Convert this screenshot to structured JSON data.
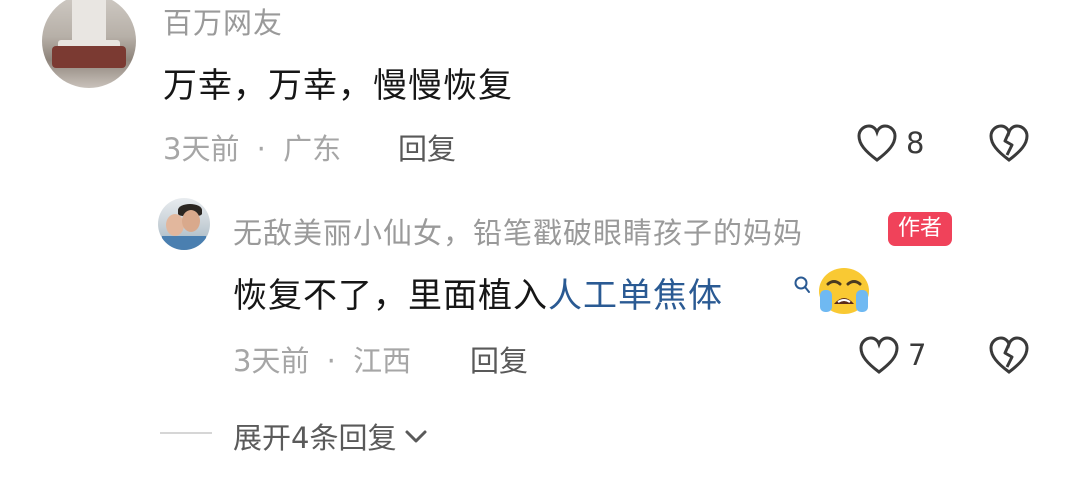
{
  "comment": {
    "username": "百万网友",
    "text": "万幸，万幸，慢慢恢复",
    "time": "3天前",
    "dot": "·",
    "location": "广东",
    "reply_label": "回复",
    "like_count": "8",
    "reply": {
      "username": "无敌美丽小仙女，铅笔戳破眼睛孩子的妈妈",
      "badge": "作者",
      "text_before": "恢复不了，里面植入",
      "link_text": "人工单焦体",
      "time": "3天前",
      "dot": "·",
      "location": "江西",
      "reply_label": "回复",
      "like_count": "7"
    },
    "expand_label": "展开4条回复"
  },
  "colors": {
    "author_badge": "#f0425a",
    "link": "#2a5a93",
    "emoji_yellow": "#f9c933"
  },
  "icons": [
    "heart-outline-icon",
    "broken-heart-icon",
    "search-small-icon",
    "crying-face-emoji",
    "chevron-down-icon"
  ]
}
